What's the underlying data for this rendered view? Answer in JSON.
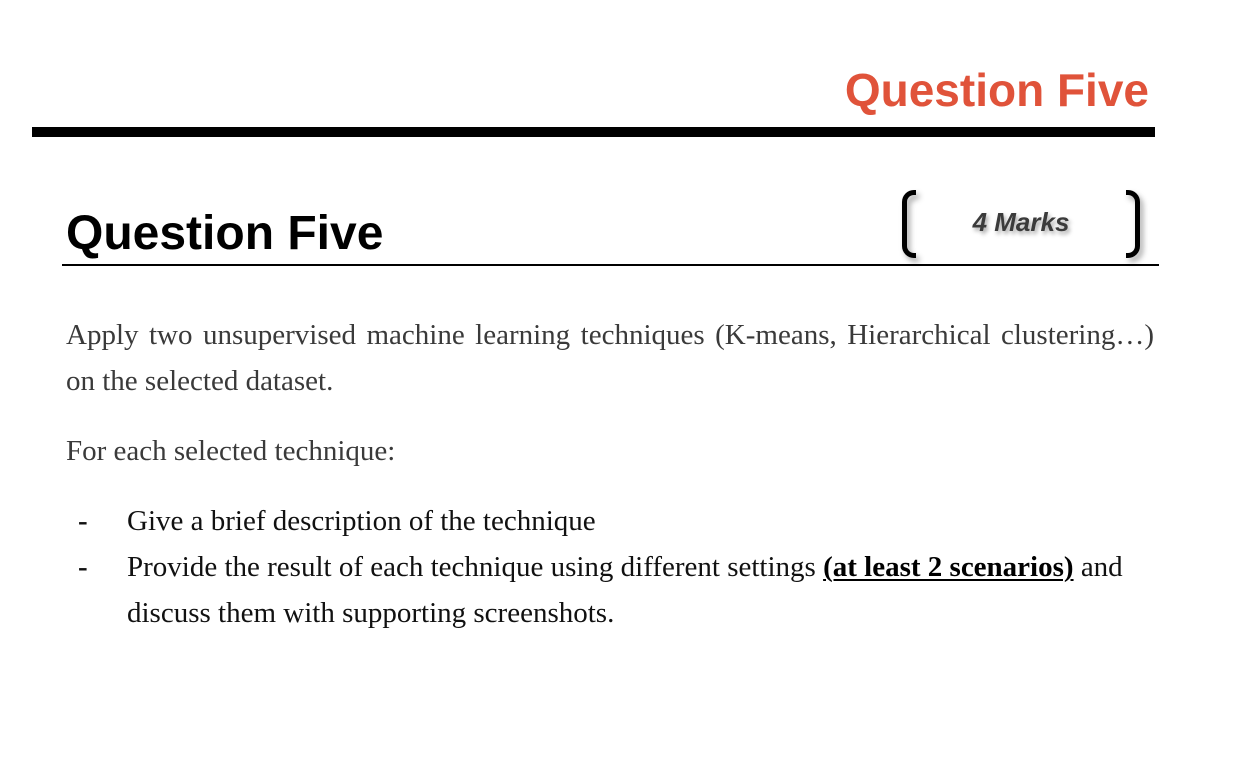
{
  "header": {
    "title": "Question Five",
    "accent_color": "#e0533a"
  },
  "section": {
    "title": "Question Five",
    "marks": "4 Marks"
  },
  "content": {
    "intro": "Apply two unsupervised machine learning techniques (K-means, Hierarchical clustering…) on the selected dataset.",
    "lead": "For each selected technique:",
    "bullets": [
      {
        "marker": "-",
        "text": "Give a brief description of the technique"
      },
      {
        "marker": "-",
        "text_before": "Provide the result of each technique using different settings ",
        "emphasis": "(at least 2 scenarios)",
        "text_after": " and discuss them with supporting screenshots."
      }
    ]
  }
}
